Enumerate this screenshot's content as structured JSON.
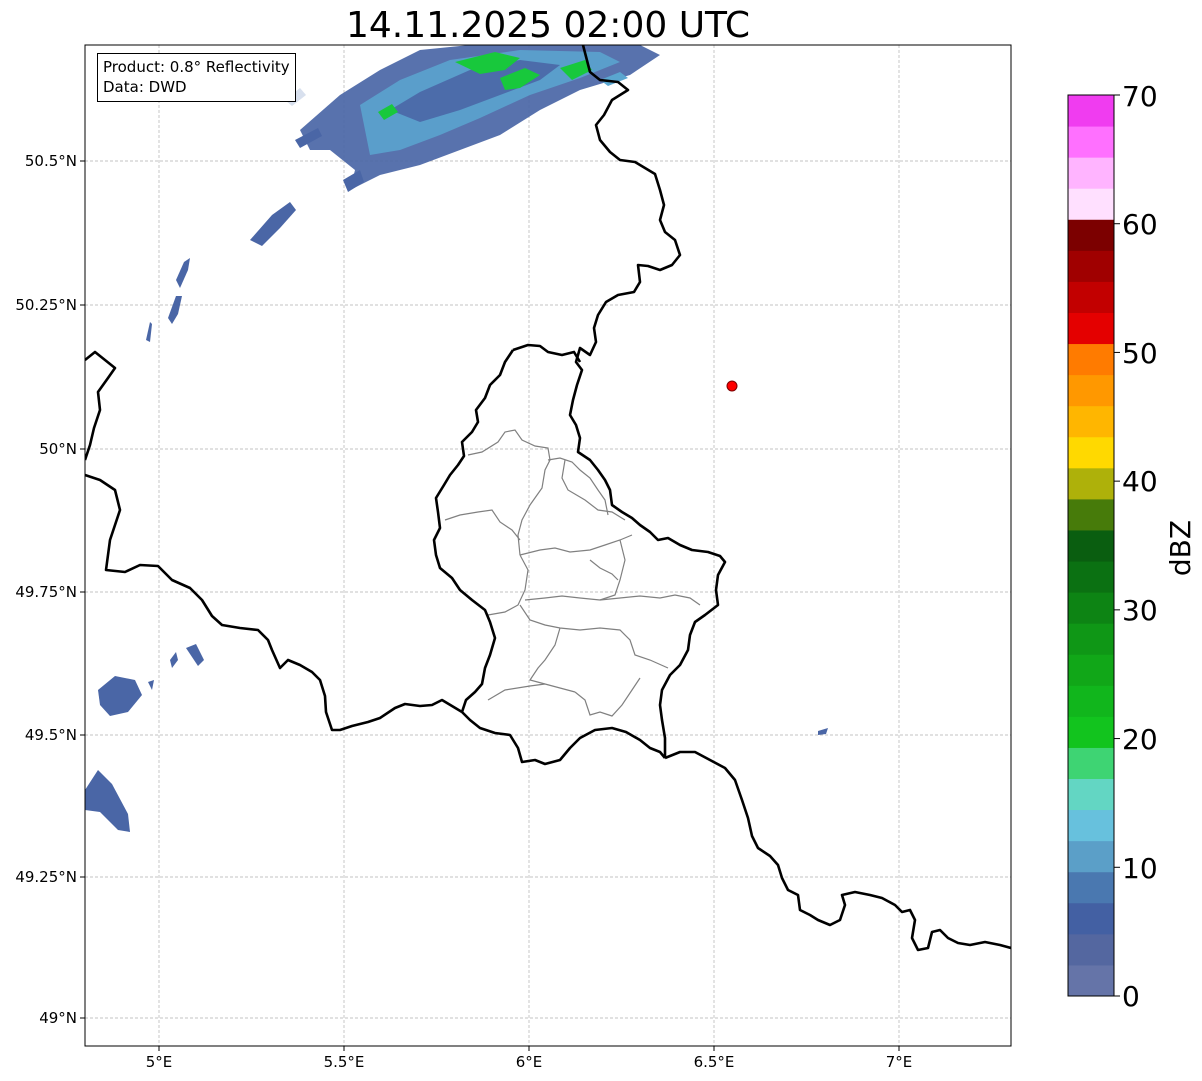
{
  "title": "14.11.2025 02:00 UTC",
  "info": {
    "product": "Product: 0.8° Reflectivity",
    "source": "Data: DWD"
  },
  "axes": {
    "lon_ticks": [
      "5°E",
      "5.5°E",
      "6°E",
      "6.5°E",
      "7°E"
    ],
    "lat_ticks": [
      "50.5°N",
      "50.25°N",
      "50°N",
      "49.75°N",
      "49.5°N",
      "49.25°N",
      "49°N"
    ],
    "lon_range": [
      4.8,
      7.3
    ],
    "lat_range": [
      48.95,
      50.7
    ],
    "grid": true
  },
  "marker": {
    "name": "radar-site-marker",
    "lon": 6.55,
    "lat": 50.11,
    "color": "#ff0000"
  },
  "colorbar": {
    "label": "dBZ",
    "ticks": [
      "0",
      "10",
      "20",
      "30",
      "40",
      "50",
      "60",
      "70"
    ],
    "colors": [
      "#6574a8",
      "#5467a0",
      "#4360a3",
      "#4a78b0",
      "#5b9fc8",
      "#67c1dd",
      "#63d6c3",
      "#3ed473",
      "#12c41e",
      "#11b61c",
      "#11a718",
      "#0f9716",
      "#0d8414",
      "#0b7112",
      "#0a5e10",
      "#477b0a",
      "#aeb10a",
      "#ffd900",
      "#ffb600",
      "#ff9800",
      "#ff7b00",
      "#e40000",
      "#c20000",
      "#a00000",
      "#7c0000",
      "#ffe0ff",
      "#ffb4ff",
      "#ff70ff",
      "#f03cf0"
    ]
  },
  "colors": {
    "country_border": "#000000",
    "admin_border": "#808080",
    "grid": "#b0b0b0",
    "echo_light": "#4a66a6",
    "echo_mid": "#5aa6d0",
    "echo_strong": "#18c83c"
  }
}
